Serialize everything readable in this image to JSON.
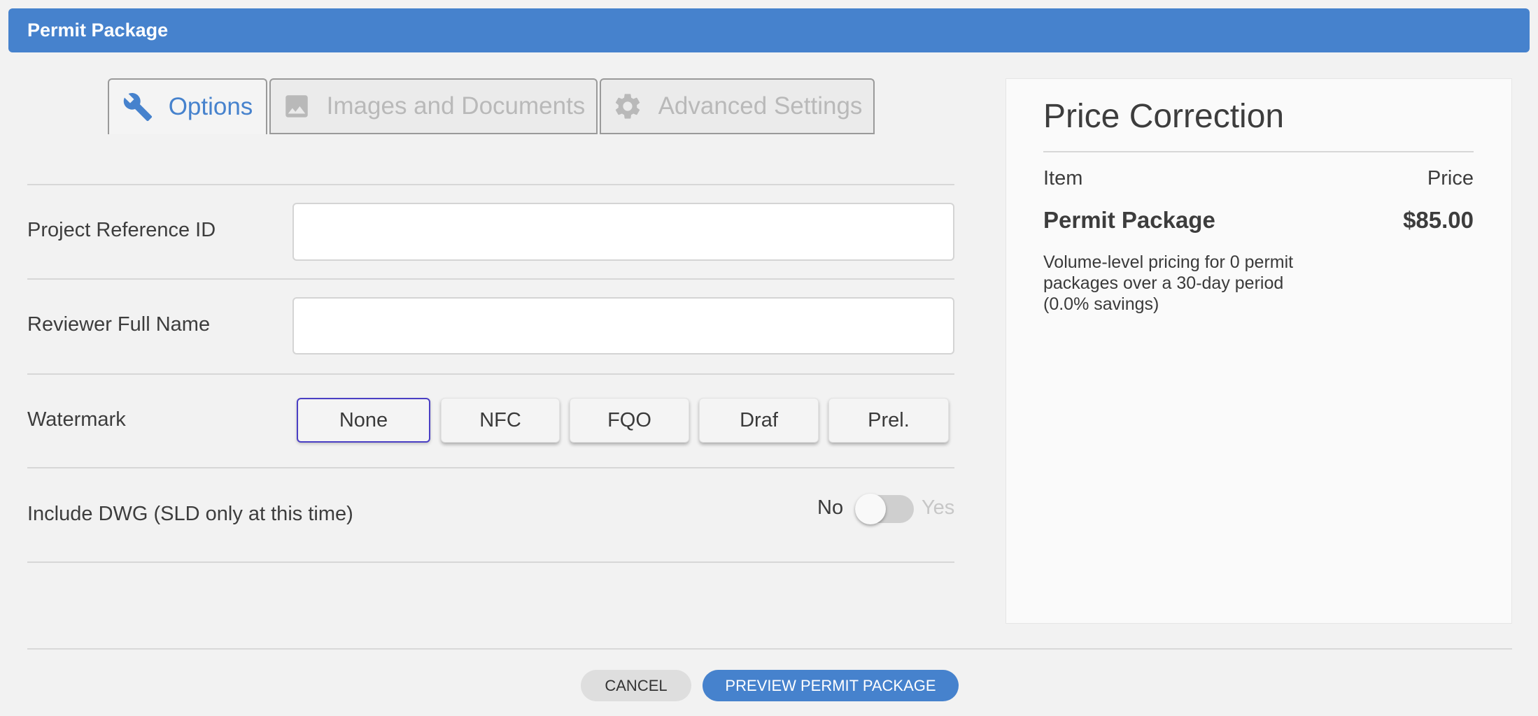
{
  "header": {
    "title": "Permit Package"
  },
  "tabs": [
    {
      "label": "Options",
      "icon": "wrench-icon",
      "active": true
    },
    {
      "label": "Images and Documents",
      "icon": "image-icon",
      "active": false
    },
    {
      "label": "Advanced Settings",
      "icon": "gear-icon",
      "active": false
    }
  ],
  "form": {
    "project_reference": {
      "label": "Project Reference ID",
      "value": "",
      "placeholder": ""
    },
    "reviewer_name": {
      "label": "Reviewer Full Name",
      "value": "",
      "placeholder": ""
    },
    "watermark": {
      "label": "Watermark",
      "options": [
        "None",
        "NFC",
        "FQO",
        "Draf",
        "Prel."
      ],
      "selected": "None"
    },
    "include_dwg": {
      "label": "Include DWG (SLD only at this time)",
      "off_label": "No",
      "on_label": "Yes",
      "value": false
    }
  },
  "price_panel": {
    "title": "Price Correction",
    "col_item": "Item",
    "col_price": "Price",
    "item_name": "Permit Package",
    "item_price": "$85.00",
    "note": "Volume-level pricing for 0 permit packages over a 30-day period (0.0% savings)"
  },
  "actions": {
    "cancel": "CANCEL",
    "preview": "PREVIEW PERMIT PACKAGE"
  },
  "colors": {
    "accent": "#4682cd",
    "selected_outline": "#4a3fc4",
    "background": "#f2f2f2"
  }
}
